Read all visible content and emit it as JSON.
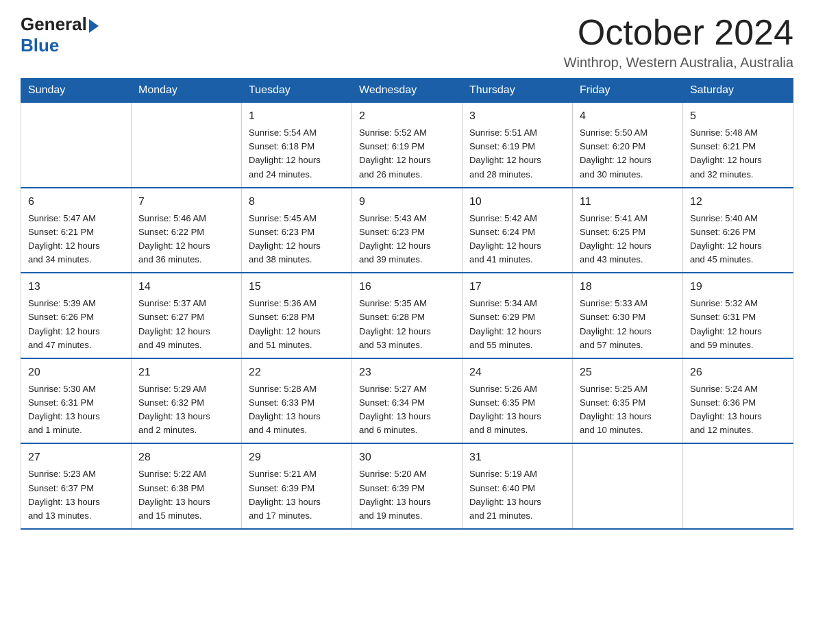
{
  "header": {
    "logo_general": "General",
    "logo_blue": "Blue",
    "title": "October 2024",
    "location": "Winthrop, Western Australia, Australia"
  },
  "weekdays": [
    "Sunday",
    "Monday",
    "Tuesday",
    "Wednesday",
    "Thursday",
    "Friday",
    "Saturday"
  ],
  "weeks": [
    [
      {
        "day": "",
        "info": ""
      },
      {
        "day": "",
        "info": ""
      },
      {
        "day": "1",
        "info": "Sunrise: 5:54 AM\nSunset: 6:18 PM\nDaylight: 12 hours\nand 24 minutes."
      },
      {
        "day": "2",
        "info": "Sunrise: 5:52 AM\nSunset: 6:19 PM\nDaylight: 12 hours\nand 26 minutes."
      },
      {
        "day": "3",
        "info": "Sunrise: 5:51 AM\nSunset: 6:19 PM\nDaylight: 12 hours\nand 28 minutes."
      },
      {
        "day": "4",
        "info": "Sunrise: 5:50 AM\nSunset: 6:20 PM\nDaylight: 12 hours\nand 30 minutes."
      },
      {
        "day": "5",
        "info": "Sunrise: 5:48 AM\nSunset: 6:21 PM\nDaylight: 12 hours\nand 32 minutes."
      }
    ],
    [
      {
        "day": "6",
        "info": "Sunrise: 5:47 AM\nSunset: 6:21 PM\nDaylight: 12 hours\nand 34 minutes."
      },
      {
        "day": "7",
        "info": "Sunrise: 5:46 AM\nSunset: 6:22 PM\nDaylight: 12 hours\nand 36 minutes."
      },
      {
        "day": "8",
        "info": "Sunrise: 5:45 AM\nSunset: 6:23 PM\nDaylight: 12 hours\nand 38 minutes."
      },
      {
        "day": "9",
        "info": "Sunrise: 5:43 AM\nSunset: 6:23 PM\nDaylight: 12 hours\nand 39 minutes."
      },
      {
        "day": "10",
        "info": "Sunrise: 5:42 AM\nSunset: 6:24 PM\nDaylight: 12 hours\nand 41 minutes."
      },
      {
        "day": "11",
        "info": "Sunrise: 5:41 AM\nSunset: 6:25 PM\nDaylight: 12 hours\nand 43 minutes."
      },
      {
        "day": "12",
        "info": "Sunrise: 5:40 AM\nSunset: 6:26 PM\nDaylight: 12 hours\nand 45 minutes."
      }
    ],
    [
      {
        "day": "13",
        "info": "Sunrise: 5:39 AM\nSunset: 6:26 PM\nDaylight: 12 hours\nand 47 minutes."
      },
      {
        "day": "14",
        "info": "Sunrise: 5:37 AM\nSunset: 6:27 PM\nDaylight: 12 hours\nand 49 minutes."
      },
      {
        "day": "15",
        "info": "Sunrise: 5:36 AM\nSunset: 6:28 PM\nDaylight: 12 hours\nand 51 minutes."
      },
      {
        "day": "16",
        "info": "Sunrise: 5:35 AM\nSunset: 6:28 PM\nDaylight: 12 hours\nand 53 minutes."
      },
      {
        "day": "17",
        "info": "Sunrise: 5:34 AM\nSunset: 6:29 PM\nDaylight: 12 hours\nand 55 minutes."
      },
      {
        "day": "18",
        "info": "Sunrise: 5:33 AM\nSunset: 6:30 PM\nDaylight: 12 hours\nand 57 minutes."
      },
      {
        "day": "19",
        "info": "Sunrise: 5:32 AM\nSunset: 6:31 PM\nDaylight: 12 hours\nand 59 minutes."
      }
    ],
    [
      {
        "day": "20",
        "info": "Sunrise: 5:30 AM\nSunset: 6:31 PM\nDaylight: 13 hours\nand 1 minute."
      },
      {
        "day": "21",
        "info": "Sunrise: 5:29 AM\nSunset: 6:32 PM\nDaylight: 13 hours\nand 2 minutes."
      },
      {
        "day": "22",
        "info": "Sunrise: 5:28 AM\nSunset: 6:33 PM\nDaylight: 13 hours\nand 4 minutes."
      },
      {
        "day": "23",
        "info": "Sunrise: 5:27 AM\nSunset: 6:34 PM\nDaylight: 13 hours\nand 6 minutes."
      },
      {
        "day": "24",
        "info": "Sunrise: 5:26 AM\nSunset: 6:35 PM\nDaylight: 13 hours\nand 8 minutes."
      },
      {
        "day": "25",
        "info": "Sunrise: 5:25 AM\nSunset: 6:35 PM\nDaylight: 13 hours\nand 10 minutes."
      },
      {
        "day": "26",
        "info": "Sunrise: 5:24 AM\nSunset: 6:36 PM\nDaylight: 13 hours\nand 12 minutes."
      }
    ],
    [
      {
        "day": "27",
        "info": "Sunrise: 5:23 AM\nSunset: 6:37 PM\nDaylight: 13 hours\nand 13 minutes."
      },
      {
        "day": "28",
        "info": "Sunrise: 5:22 AM\nSunset: 6:38 PM\nDaylight: 13 hours\nand 15 minutes."
      },
      {
        "day": "29",
        "info": "Sunrise: 5:21 AM\nSunset: 6:39 PM\nDaylight: 13 hours\nand 17 minutes."
      },
      {
        "day": "30",
        "info": "Sunrise: 5:20 AM\nSunset: 6:39 PM\nDaylight: 13 hours\nand 19 minutes."
      },
      {
        "day": "31",
        "info": "Sunrise: 5:19 AM\nSunset: 6:40 PM\nDaylight: 13 hours\nand 21 minutes."
      },
      {
        "day": "",
        "info": ""
      },
      {
        "day": "",
        "info": ""
      }
    ]
  ]
}
